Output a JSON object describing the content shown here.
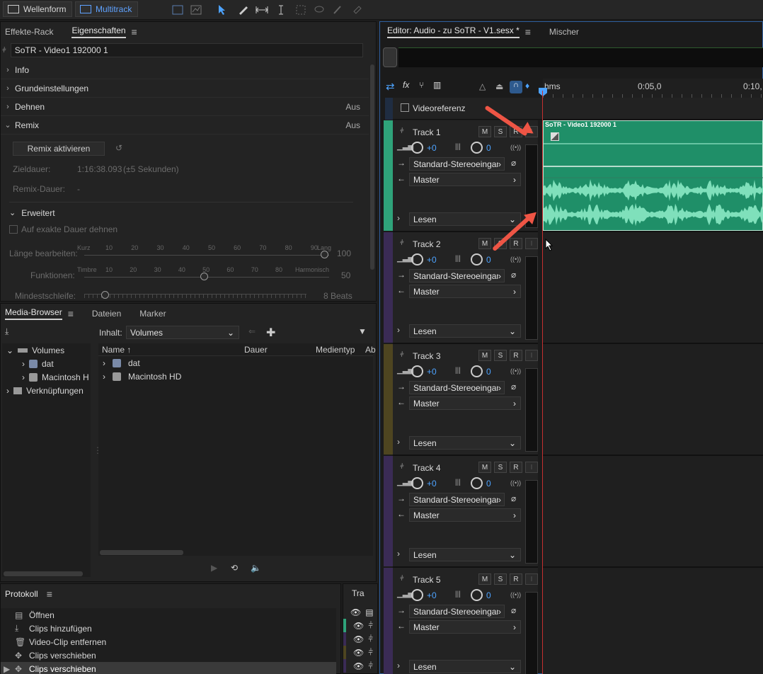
{
  "toolbar": {
    "waveform_label": "Wellenform",
    "multitrack_label": "Multitrack"
  },
  "left_panel": {
    "tabs": [
      "Effekte-Rack",
      "Eigenschaften"
    ],
    "clip_name": "SoTR - Video1 192000 1",
    "sections": [
      {
        "label": "Info",
        "value": ""
      },
      {
        "label": "Grundeinstellungen",
        "value": ""
      },
      {
        "label": "Dehnen",
        "value": "Aus"
      },
      {
        "label": "Remix",
        "value": "Aus"
      }
    ],
    "remix_button": "Remix aktivieren",
    "zieldauer_label": "Zieldauer:",
    "zieldauer_value": "1:16:38.093",
    "zieldauer_hint": "(±5 Sekunden)",
    "remixdauer_label": "Remix-Dauer:",
    "remixdauer_value": "-",
    "advanced_label": "Erweitert",
    "exact_label": "Auf exakte Dauer dehnen",
    "laenge_label": "Länge bearbeiten:",
    "laenge_low": "Kurz",
    "laenge_high": "Lang",
    "laenge_value": "100",
    "funktionen_label": "Funktionen:",
    "funktionen_low": "Timbre",
    "funktionen_high": "Harmonisch",
    "funktionen_value": "50",
    "schleife_label": "Mindestschleife:",
    "schleife_value": "8 Beats",
    "ticks": [
      "10",
      "20",
      "30",
      "40",
      "50",
      "60",
      "70",
      "80",
      "90"
    ]
  },
  "media": {
    "tabs": [
      "Media-Browser",
      "Dateien",
      "Marker"
    ],
    "inhalt_label": "Inhalt:",
    "inhalt_value": "Volumes",
    "tree": [
      "Volumes",
      "dat",
      "Macintosh H",
      "Verknüpfungen"
    ],
    "cols": [
      "Name",
      "Dauer",
      "Medientyp",
      "Ab"
    ],
    "files": [
      "dat",
      "Macintosh HD"
    ]
  },
  "history": {
    "title": "Protokoll",
    "items": [
      "Öffnen",
      "Clips hinzufügen",
      "Video-Clip entfernen",
      "Clips verschieben",
      "Clips verschieben"
    ],
    "side_tab": "Tra"
  },
  "editor": {
    "tab": "Editor: Audio - zu SoTR - V1.sesx *",
    "mixer_tab": "Mischer",
    "ruler": [
      "hms",
      "0:05,0",
      "0:10,"
    ],
    "videoreferenz": "Videoreferenz",
    "clip_label": "SoTR - Video1 192000 1",
    "input_label": "Standard-Stereoeingang",
    "output_label": "Master",
    "read_label": "Lesen",
    "vol": "+0",
    "pan": "0",
    "buttons": [
      "M",
      "S",
      "R",
      "I"
    ],
    "tracks": [
      {
        "name": "Track 1",
        "color": "#2fa37a"
      },
      {
        "name": "Track 2",
        "color": "#3a2b55"
      },
      {
        "name": "Track 3",
        "color": "#4e4520"
      },
      {
        "name": "Track 4",
        "color": "#3a2b55"
      },
      {
        "name": "Track 5",
        "color": "#3a2b55"
      }
    ]
  }
}
